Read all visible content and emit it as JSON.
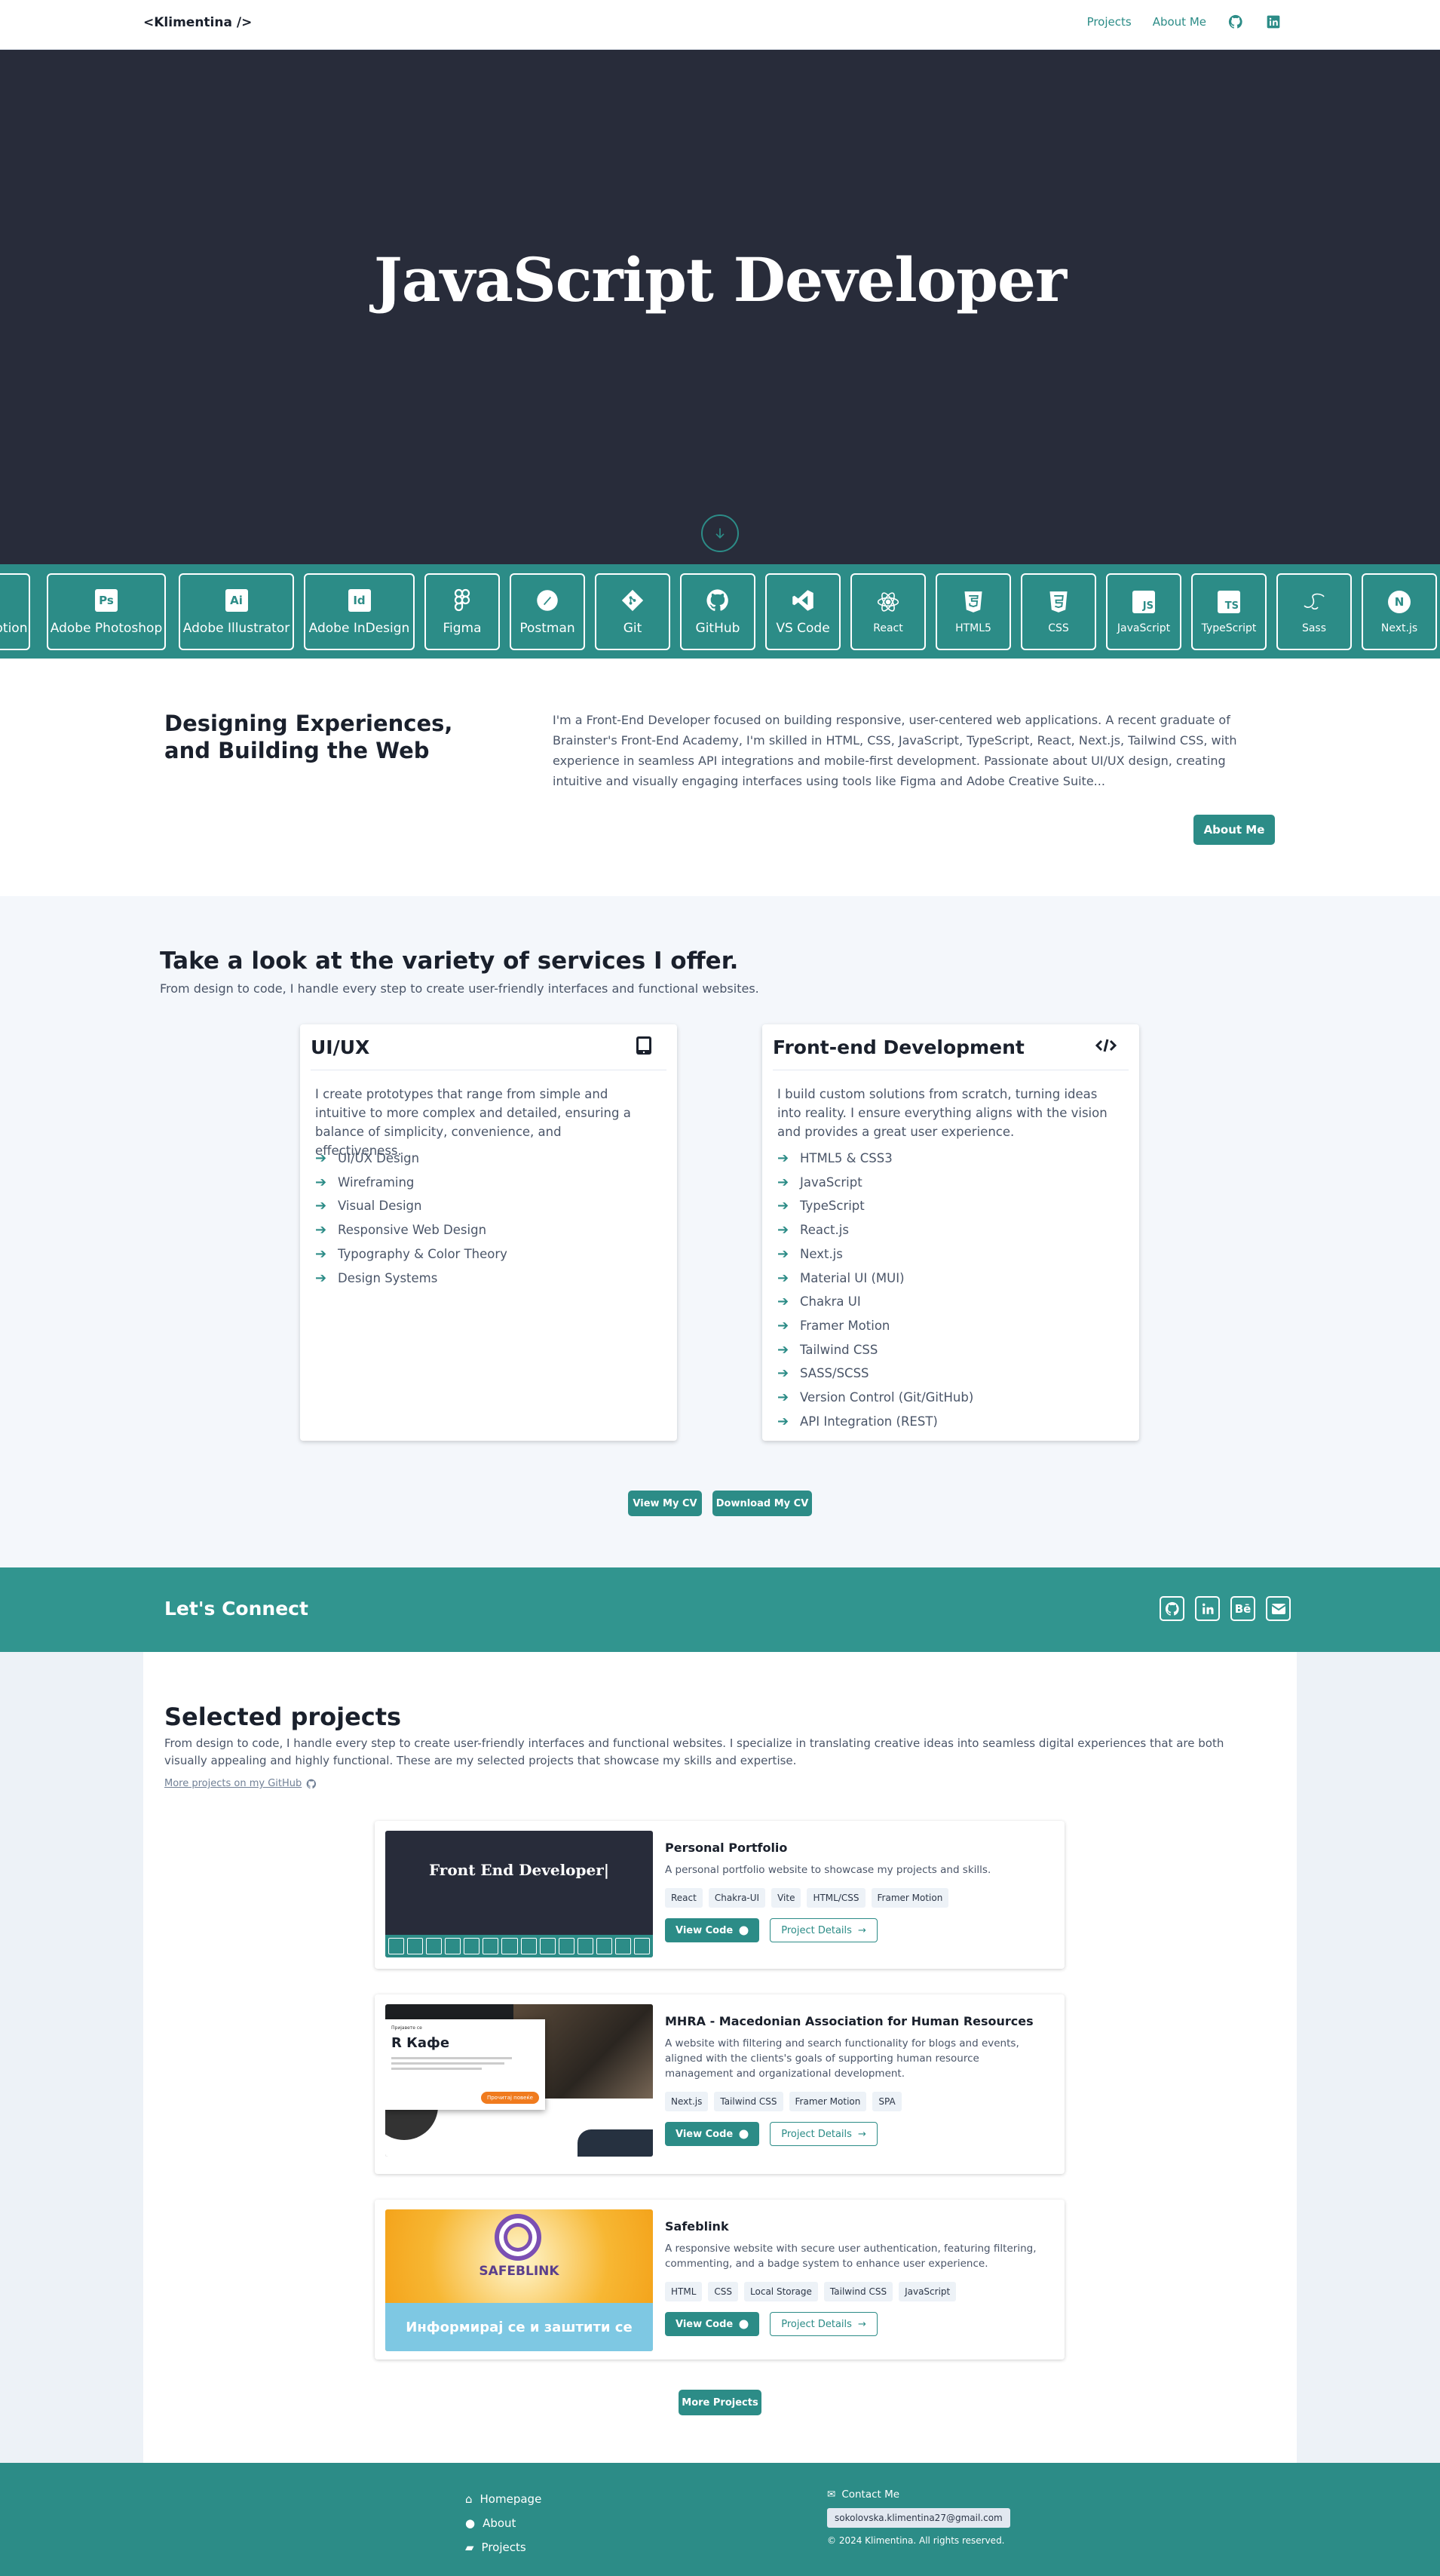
{
  "nav": {
    "logo": "<Klimentina />",
    "links": [
      "Projects",
      "About Me"
    ],
    "icons": [
      "github-icon",
      "linkedin-icon"
    ]
  },
  "hero": {
    "title": "JavaScript Developer"
  },
  "tools": [
    "otion",
    "Adobe Photoshop",
    "Adobe Illustrator",
    "Adobe InDesign",
    "Figma",
    "Postman",
    "Git",
    "GitHub",
    "VS Code",
    "React",
    "HTML5",
    "CSS",
    "JavaScript",
    "TypeScript",
    "Sass",
    "Next.js"
  ],
  "tool_badges": {
    "ps": "Ps",
    "ai": "Ai",
    "id": "Id",
    "js": "JS",
    "ts": "TS",
    "next": "N"
  },
  "intro": {
    "heading": "Designing Experiences, and Building the Web",
    "text": "I'm a Front-End Developer focused on building responsive, user-centered web applications. A recent graduate of Brainster's Front-End Academy, I'm skilled in HTML, CSS, JavaScript, TypeScript, React, Next.js, Tailwind CSS, with experience in seamless API integrations and mobile-first development. Passionate about UI/UX design, creating intuitive and visually engaging interfaces using tools like Figma and Adobe Creative Suite...",
    "button": "About Me"
  },
  "services": {
    "heading": "Take a look at the variety of services I offer.",
    "subtitle": "From design to code, I handle every step to create user-friendly interfaces and functional websites.",
    "cards": [
      {
        "title": "UI/UX",
        "icon": "tablet-icon",
        "desc": "I create prototypes that range from simple and intuitive to more complex and detailed, ensuring a balance of simplicity, convenience, and effectiveness.",
        "items": [
          "UI/UX Design",
          "Wireframing",
          "Visual Design",
          "Responsive Web Design",
          "Typography & Color Theory",
          "Design Systems"
        ]
      },
      {
        "title": "Front-end Development",
        "icon": "code-icon",
        "desc": "I build custom solutions from scratch, turning ideas into reality. I ensure everything aligns with the vision and provides a great user experience.",
        "items": [
          "HTML5 & CSS3",
          "JavaScript",
          "TypeScript",
          "React.js",
          "Next.js",
          "Material UI (MUI)",
          "Chakra UI",
          "Framer Motion",
          "Tailwind CSS",
          "SASS/SCSS",
          "Version Control (Git/GitHub)",
          "API Integration (REST)"
        ]
      }
    ],
    "view_cv": "View My CV",
    "download_cv": "Download My CV"
  },
  "connect": {
    "title": "Let's Connect",
    "behance": "Bē"
  },
  "projects": {
    "heading": "Selected projects",
    "description": "From design to code, I handle every step to create user-friendly interfaces and functional websites. I specialize in translating creative ideas into seamless digital experiences that are both visually appealing and highly functional. These are my selected projects that showcase my skills and expertise.",
    "github_link": "More projects on my GitHub",
    "items": [
      {
        "title": "Personal Portfolio",
        "desc": "A personal portfolio website to showcase my projects and skills.",
        "tags": [
          "React",
          "Chakra-UI",
          "Vite",
          "HTML/CSS",
          "Framer Motion"
        ],
        "thumb_text": "Front End Developer|"
      },
      {
        "title": "MHRA - Macedonian Association for Human Resources",
        "desc": "A website with filtering and search functionality for blogs and events, aligned with the clients's goals of supporting human resource management and organizational development.",
        "tags": [
          "Next.js",
          "Tailwind CSS",
          "Framer Motion",
          "SPA"
        ],
        "thumb_text": "R Кафе",
        "thumb_small": "Пријавете се",
        "thumb_caption": "Прочитај повеќе"
      },
      {
        "title": "Safeblink",
        "desc": "A responsive website with secure user authentication, featuring filtering, commenting, and a badge system to enhance user experience.",
        "tags": [
          "HTML",
          "CSS",
          "Local Storage",
          "Tailwind CSS",
          "JavaScript"
        ],
        "thumb_text": "SAFEBLINK",
        "thumb_banner": "Информирај се и заштити се"
      }
    ],
    "view_code": "View Code",
    "details": "Project Details",
    "more": "More Projects"
  },
  "footer": {
    "links": [
      "Homepage",
      "About",
      "Projects"
    ],
    "contact": "Contact Me",
    "email": "sokolovska.klimentina27@gmail.com",
    "copyright": "© 2024 Klimentina. All rights reserved."
  }
}
